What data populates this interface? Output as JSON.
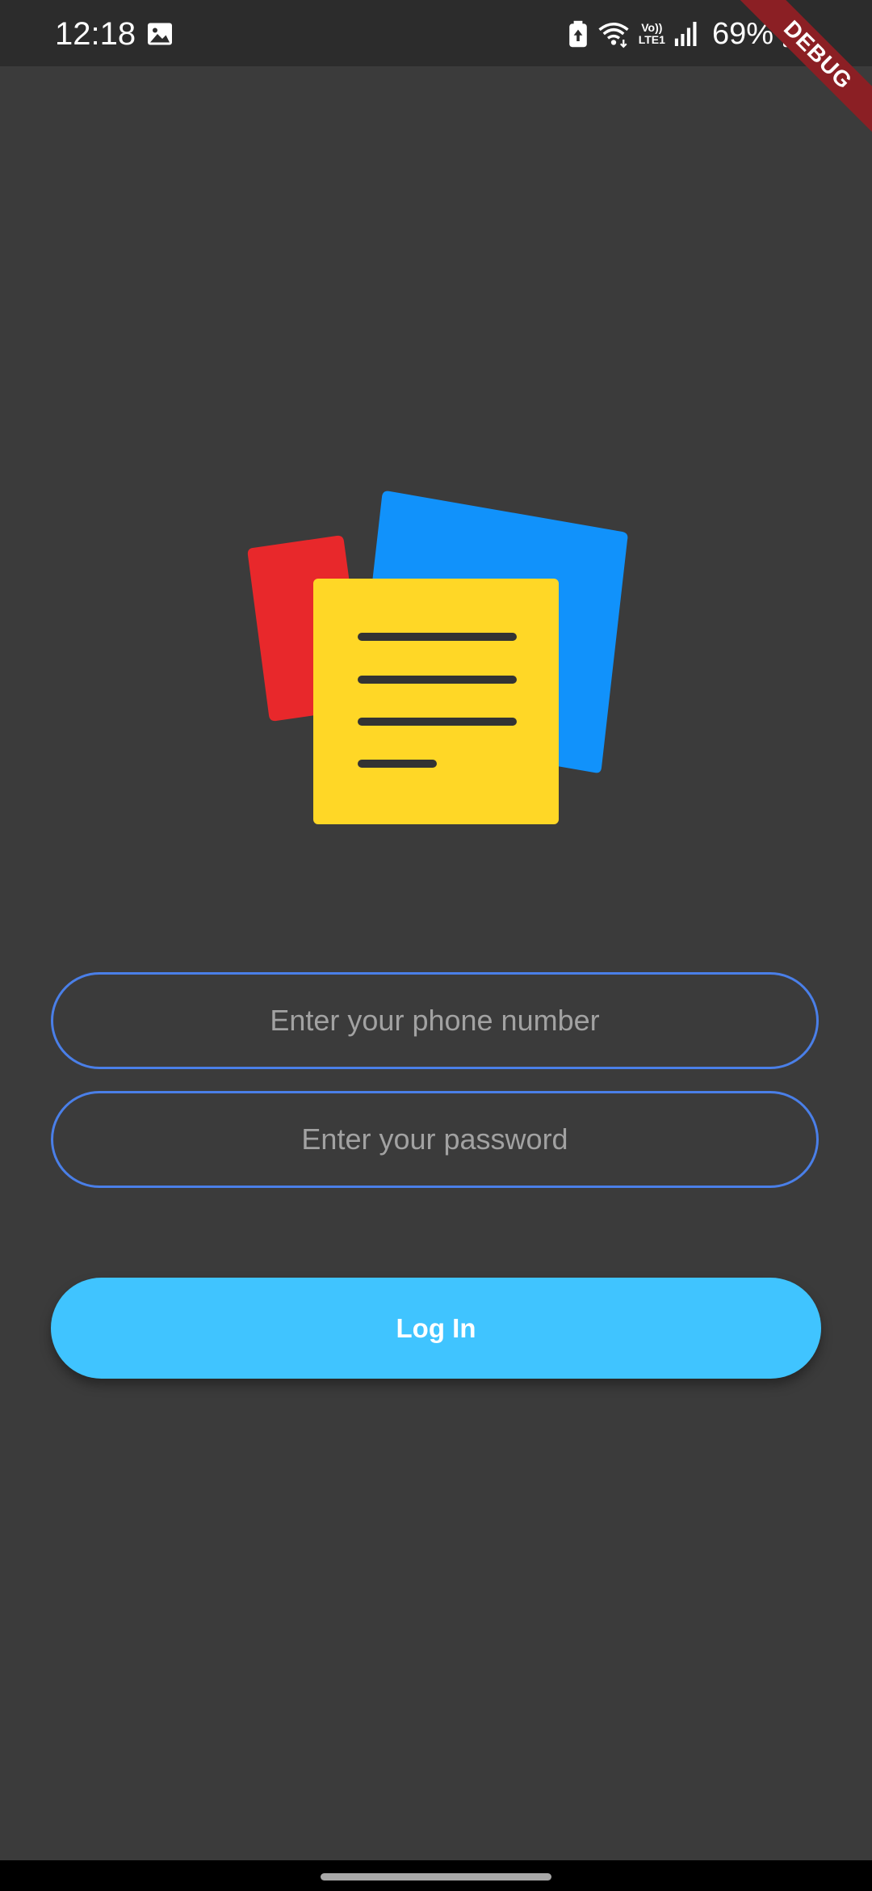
{
  "status_bar": {
    "time": "12:18",
    "battery": "69%",
    "volte_top": "Vo))",
    "volte_bottom": "LTE1",
    "icons": [
      "gallery-icon",
      "battery-saver-icon",
      "wifi-icon",
      "volte-icon",
      "signal-icon",
      "battery-icon"
    ]
  },
  "debug_banner": {
    "label": "DEBUG"
  },
  "logo": {
    "name": "notes-logo-icon",
    "colors": {
      "red": "#e8282b",
      "blue": "#1192fb",
      "yellow": "#ffd726",
      "lines": "#333333"
    }
  },
  "login_form": {
    "phone_placeholder": "Enter your phone number",
    "phone_value": "",
    "password_placeholder": "Enter your password",
    "password_value": "",
    "login_label": "Log In"
  },
  "theme": {
    "background": "#3b3b3b",
    "status_bar": "#2c2c2c",
    "field_border": "#4a7fe8",
    "button": "#40c4ff",
    "placeholder": "#a2a2a2"
  }
}
